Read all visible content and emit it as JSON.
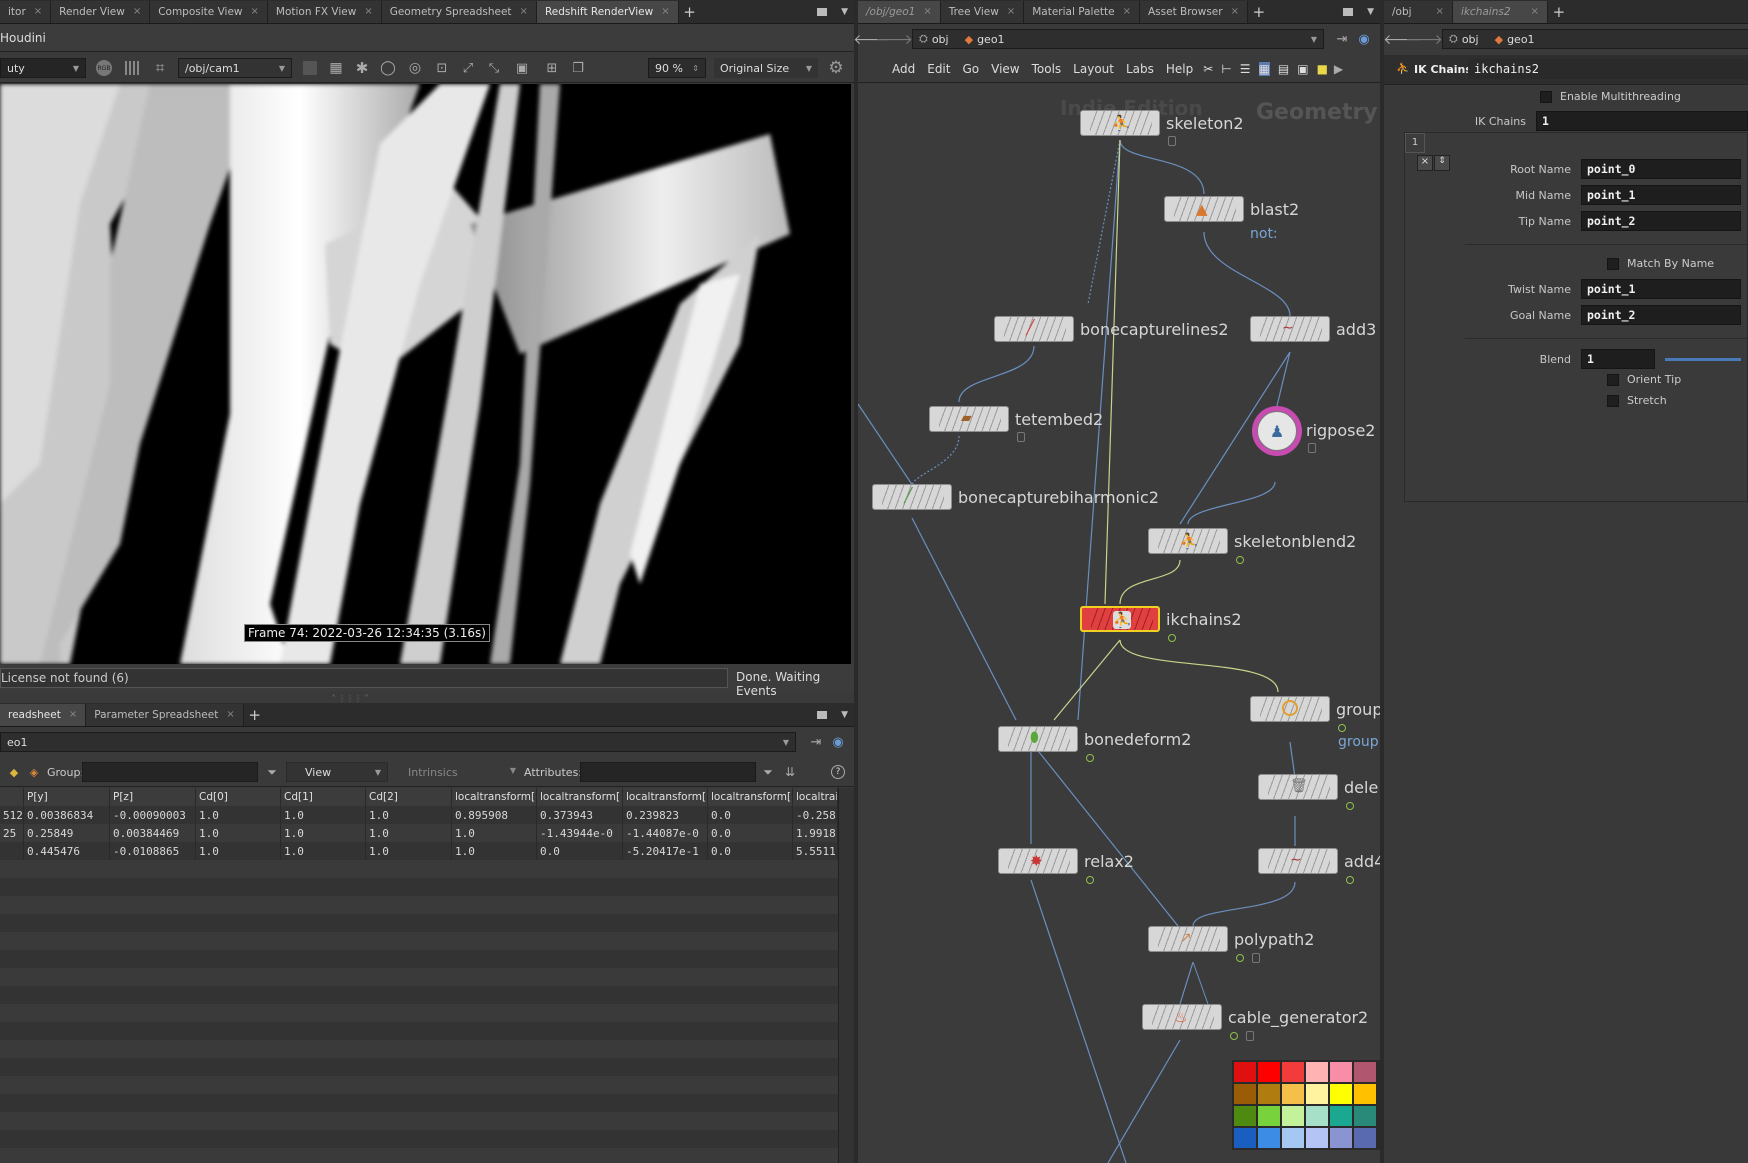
{
  "left": {
    "tabs": [
      "itor",
      "Render View",
      "Composite View",
      "Motion FX View",
      "Geometry Spreadsheet",
      "Redshift RenderView"
    ],
    "title": "Houdini",
    "toolbar": {
      "aov": "uty",
      "camera": "/obj/cam1",
      "zoom": "90 %",
      "size": "Original Size"
    },
    "frame_info": "Frame 74: 2022-03-26 12:34:35 (3.16s)",
    "status_left": "License not found (6)",
    "status_right": "Done. Waiting Events"
  },
  "spreadsheet": {
    "tabs": [
      "readsheet",
      "Parameter Spreadsheet"
    ],
    "path": "eo1",
    "group_label": "Group:",
    "view_label": "View",
    "intrinsics_label": "Intrinsics",
    "attributes_label": "Attributes:",
    "columns": [
      "",
      "P[y]",
      "P[z]",
      "Cd[0]",
      "Cd[1]",
      "Cd[2]",
      "localtransform[",
      "localtransform[",
      "localtransform[",
      "localtransform[",
      "localtrai"
    ],
    "rows": [
      [
        "512",
        "0.00386834",
        "-0.00090003",
        "1.0",
        "1.0",
        "1.0",
        "0.895908",
        "0.373943",
        "0.239823",
        "0.0",
        "-0.258"
      ],
      [
        "25",
        "0.25849",
        "0.00384469",
        "1.0",
        "1.0",
        "1.0",
        "1.0",
        "-1.43944e-0",
        "-1.44087e-0",
        "0.0",
        "1.9918"
      ],
      [
        "",
        "0.445476",
        "-0.0108865",
        "1.0",
        "1.0",
        "1.0",
        "1.0",
        "0.0",
        "-5.20417e-1",
        "0.0",
        "5.5511"
      ]
    ]
  },
  "network": {
    "tabs": [
      "/obj/geo1",
      "Tree View",
      "Material Palette",
      "Asset Browser"
    ],
    "path": [
      "obj",
      "geo1"
    ],
    "menu": [
      "Add",
      "Edit",
      "Go",
      "View",
      "Tools",
      "Layout",
      "Labs",
      "Help"
    ],
    "watermark_left": "Indie Edition",
    "watermark_right": "Geometry",
    "nodes": {
      "skeleton2": "skeleton2",
      "blast2": "blast2",
      "blast2_sub": "not:",
      "bonecapturelines2": "bonecapturelines2",
      "add3": "add3",
      "tetembed2": "tetembed2",
      "rigpose2": "rigpose2",
      "bonecapturebiharmonic2": "bonecapturebiharmonic2",
      "skeletonblend2": "skeletonblend2",
      "ikchains2": "ikchains2",
      "group": "group",
      "group_sub": "group",
      "bonedeform2": "bonedeform2",
      "dele": "dele",
      "relax2": "relax2",
      "add4": "add4",
      "polypath2": "polypath2",
      "cable_generator2": "cable_generator2"
    },
    "palette_colors": [
      "#e01010",
      "#ff0000",
      "#f23c3c",
      "#ffb3b3",
      "#f78da7",
      "#b0566e",
      "#9a5c05",
      "#b07c10",
      "#f4c04a",
      "#fff3a0",
      "#ffff00",
      "#ffc000",
      "#4f8a10",
      "#78d23c",
      "#c4f29a",
      "#a6e0c8",
      "#1aa890",
      "#2a8a7a",
      "#1a5ec0",
      "#3c8ce6",
      "#a4c8f2",
      "#b4c4f4",
      "#8a94d0",
      "#5a6ab0"
    ]
  },
  "params": {
    "tabs": [
      "/obj",
      "ikchains2"
    ],
    "path": [
      "obj",
      "geo1"
    ],
    "type_label": "IK Chains",
    "node_name": "ikchains2",
    "enable_mt": "Enable Multithreading",
    "ik_chains_label": "IK Chains",
    "ik_chains_value": "1",
    "multiparm_index": "1",
    "root_name_label": "Root Name",
    "root_name": "point_0",
    "mid_name_label": "Mid Name",
    "mid_name": "point_1",
    "tip_name_label": "Tip Name",
    "tip_name": "point_2",
    "match_by_name": "Match By Name",
    "twist_name_label": "Twist Name",
    "twist_name": "point_1",
    "goal_name_label": "Goal Name",
    "goal_name": "point_2",
    "blend_label": "Blend",
    "blend_value": "1",
    "orient_tip": "Orient Tip",
    "stretch": "Stretch"
  }
}
